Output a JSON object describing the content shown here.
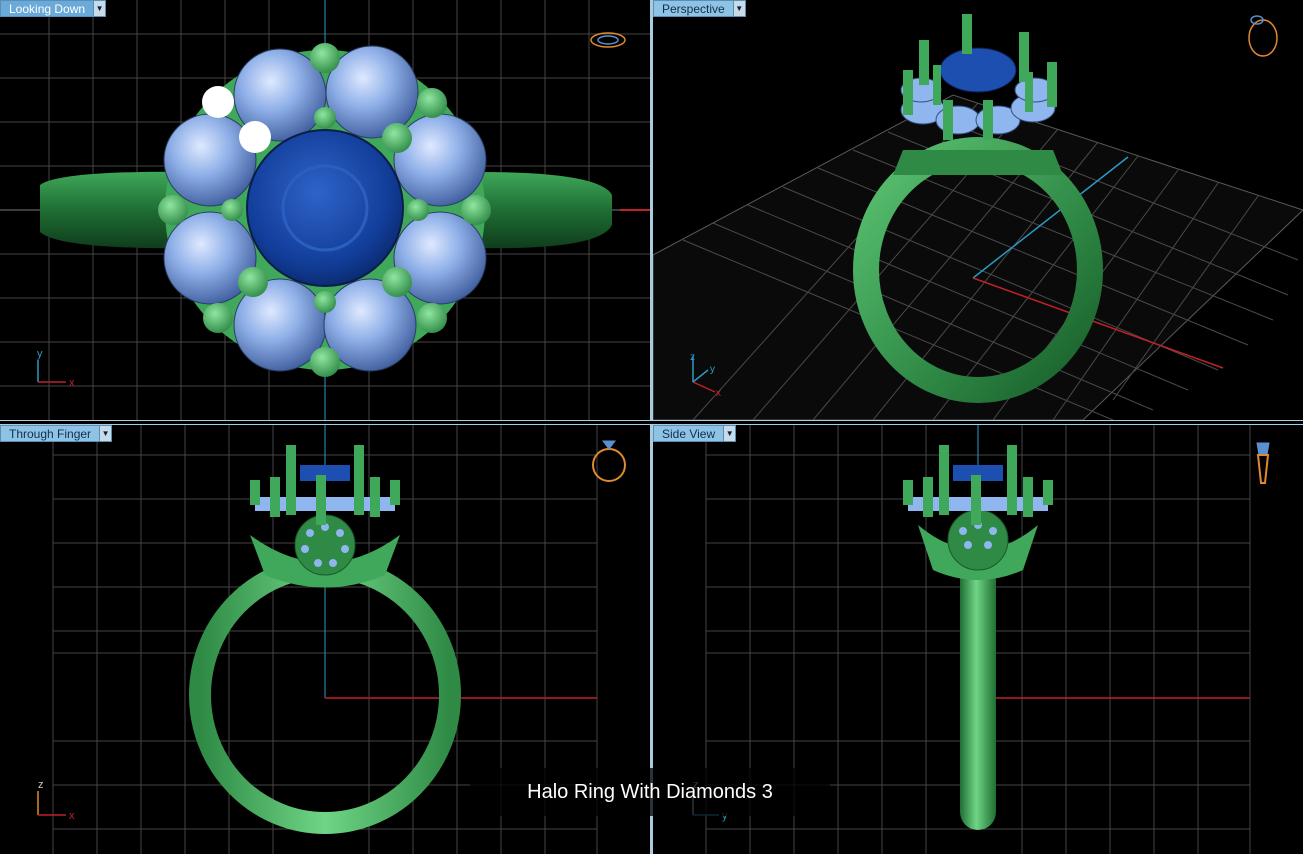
{
  "viewports": {
    "top": {
      "label": "Looking Down"
    },
    "persp": {
      "label": "Perspective"
    },
    "front": {
      "label": "Through Finger"
    },
    "side": {
      "label": "Side View"
    }
  },
  "axes": {
    "x": "x",
    "y": "y",
    "z": "z"
  },
  "caption": "Halo Ring With Diamonds 3",
  "colors": {
    "metal": "#3fa85a",
    "sapphire": "#1d4fb0",
    "diamond": "#8fb6ee",
    "grid": "#4a4a4a",
    "viewport_tab": "#8fc3e6",
    "axis_x": "#c0202a",
    "axis_y": "#2a9bc4",
    "nav_icon": "#e08a30"
  },
  "icons": [
    "dropdown-arrow-icon",
    "ring-top-nav-icon",
    "ring-perspective-nav-icon",
    "ring-front-nav-icon",
    "ring-side-nav-icon"
  ]
}
